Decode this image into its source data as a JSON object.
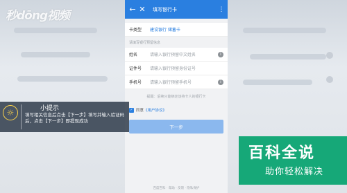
{
  "watermark": {
    "text": "秒dōng视频"
  },
  "appbar": {
    "back_icon": "←",
    "close_icon": "✕",
    "title": "填写银行卡",
    "menu_icon": "⋮"
  },
  "card": {
    "type_label": "卡类型",
    "type_value": "建设银行 储蓄卡"
  },
  "section_hint": "请填写银行预留信息",
  "fields": [
    {
      "label": "姓名",
      "placeholder": "请输入银行预留中文姓名"
    },
    {
      "label": "证件号",
      "placeholder": "请输入银行预留身份证号"
    },
    {
      "label": "手机号",
      "placeholder": "请输入银行预留手机号"
    }
  ],
  "note": "提醒：后续只能绑定该持卡人的银行卡",
  "agreement": {
    "checkbox": "✓",
    "prefix": "同意",
    "link": "《用户协议》"
  },
  "next_button": "下一步",
  "footer": "百度百科 · 帮助 · 反馈 · 隐私保护",
  "tip": {
    "icon": "💡",
    "title": "小提示",
    "text": "填写相关信息后点击【下一步】填写并输入验证码后，点击【下一步】即提现成功"
  },
  "brand": {
    "main": "百科全说",
    "sub": "助你轻松解决"
  },
  "colors": {
    "primary": "#2a7fe0",
    "brand_green": "#16a878"
  }
}
